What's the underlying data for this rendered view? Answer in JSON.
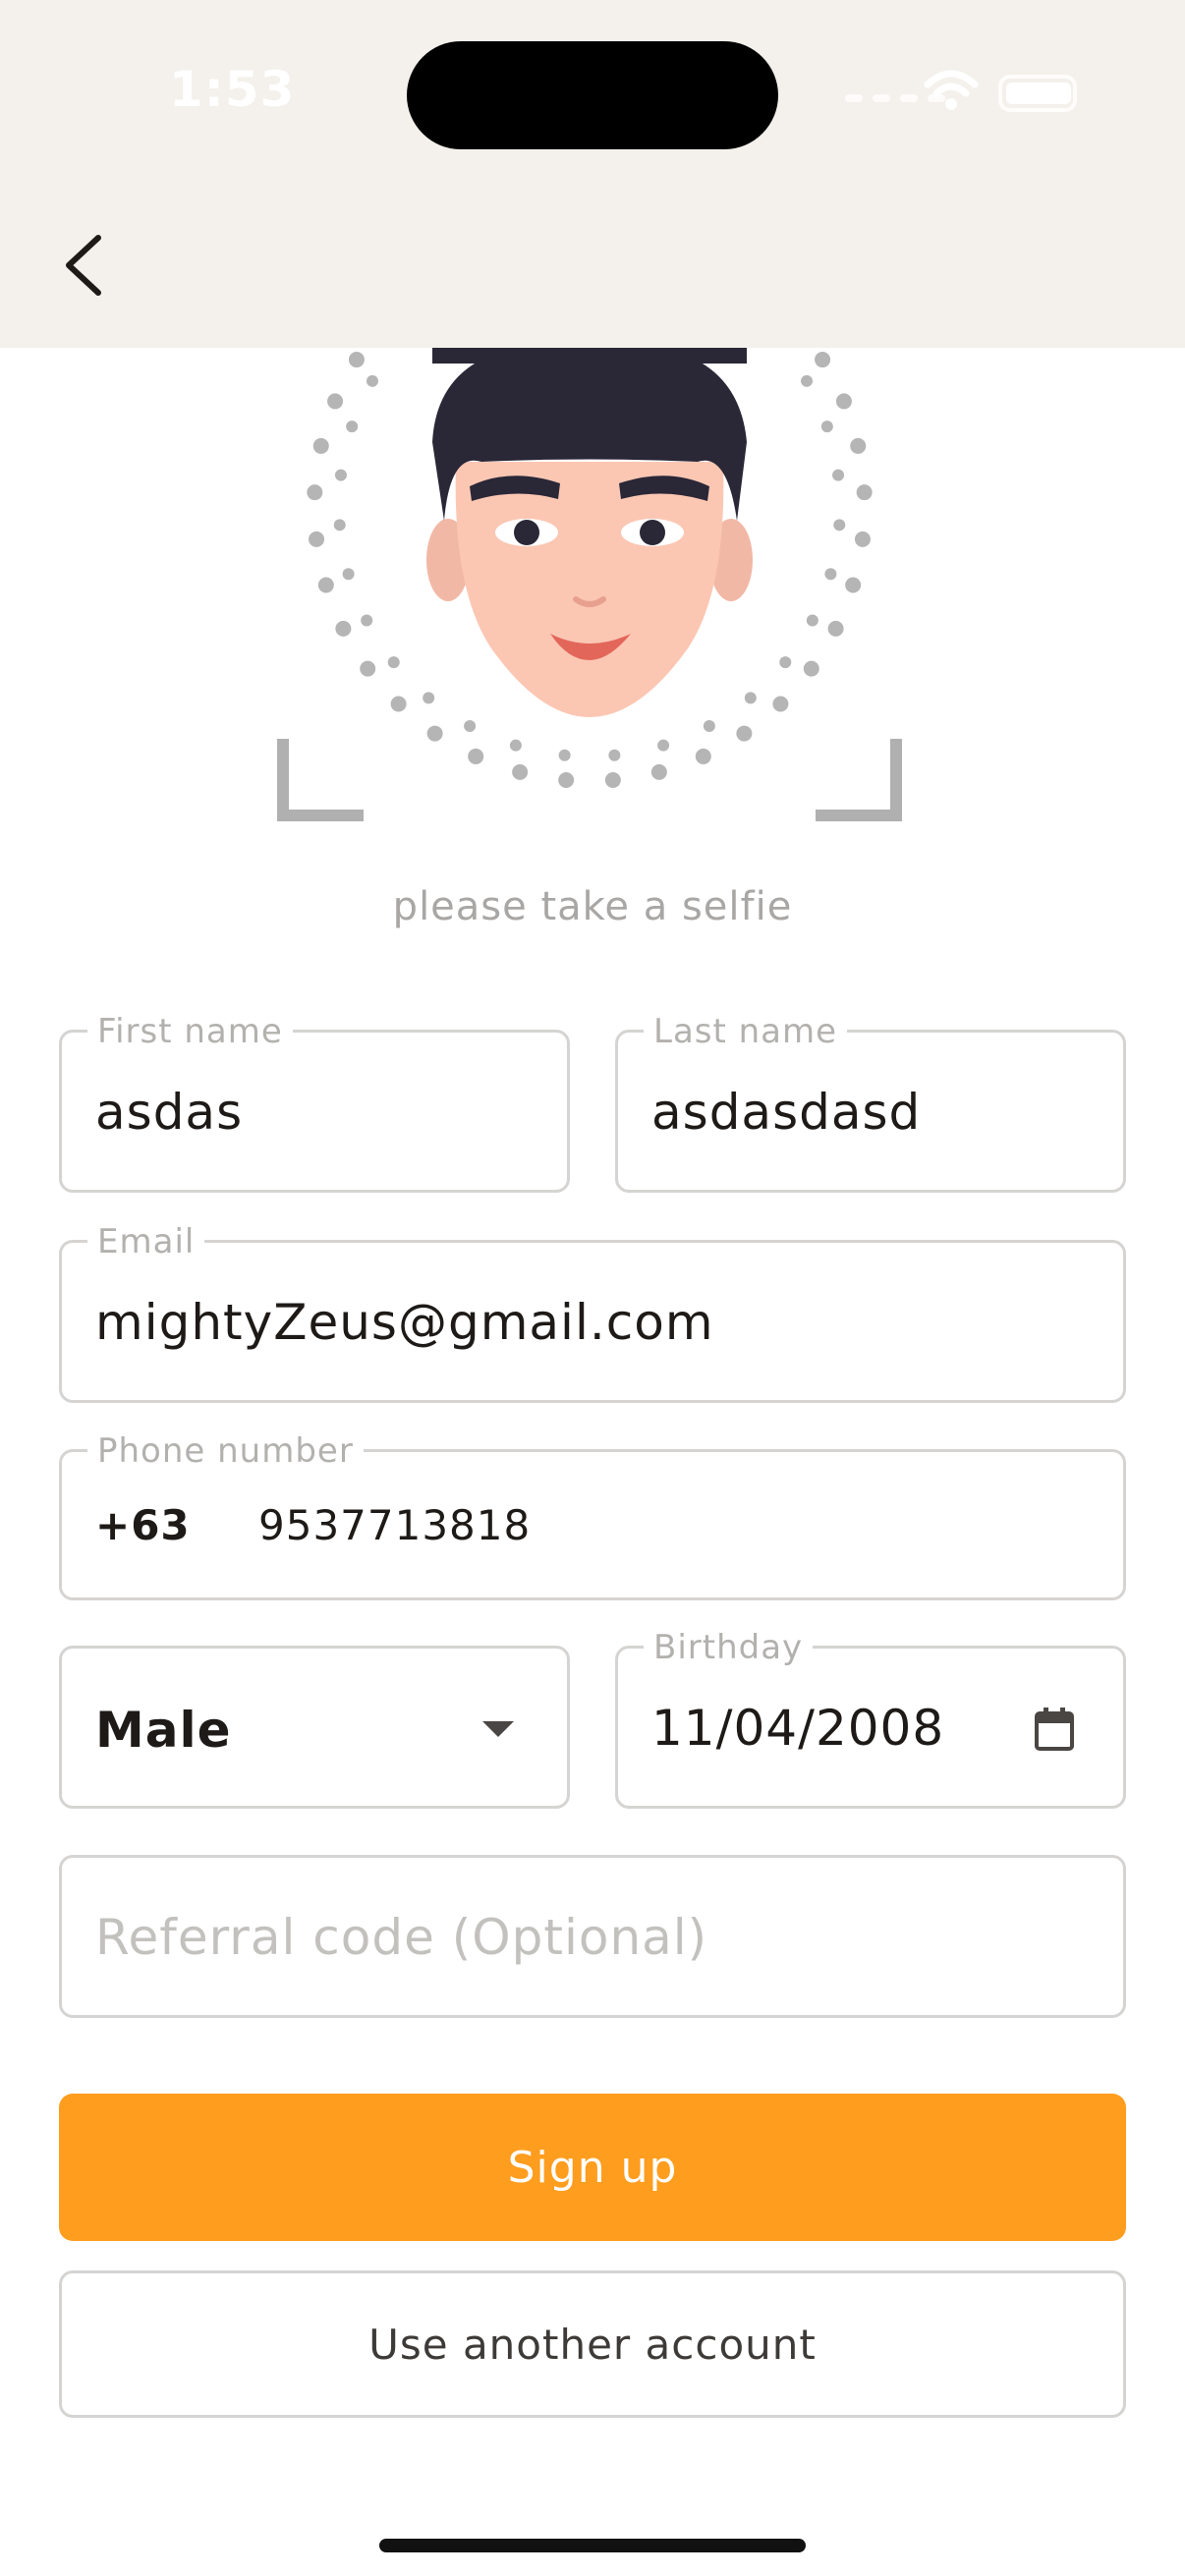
{
  "status_bar": {
    "time": "1:53"
  },
  "selfie": {
    "caption": "please take a selfie"
  },
  "form": {
    "first_name": {
      "label": "First name",
      "value": "asdas"
    },
    "last_name": {
      "label": "Last name",
      "value": "asdasdasd"
    },
    "email": {
      "label": "Email",
      "value": "mightyZeus@gmail.com"
    },
    "phone": {
      "label": "Phone number",
      "dial_code": "+63",
      "value": "9537713818"
    },
    "gender": {
      "value": "Male"
    },
    "birthday": {
      "label": "Birthday",
      "value": "11/04/2008"
    },
    "referral": {
      "placeholder": "Referral code (Optional)"
    }
  },
  "buttons": {
    "sign_up": "Sign up",
    "use_another": "Use another account"
  },
  "colors": {
    "accent": "#ff9d1e",
    "header_bg": "#f4f1ec"
  },
  "icons": [
    "back-chevron-icon",
    "wifi-icon",
    "battery-icon",
    "dropdown-arrow-icon",
    "calendar-icon",
    "selfie-face-icon"
  ]
}
